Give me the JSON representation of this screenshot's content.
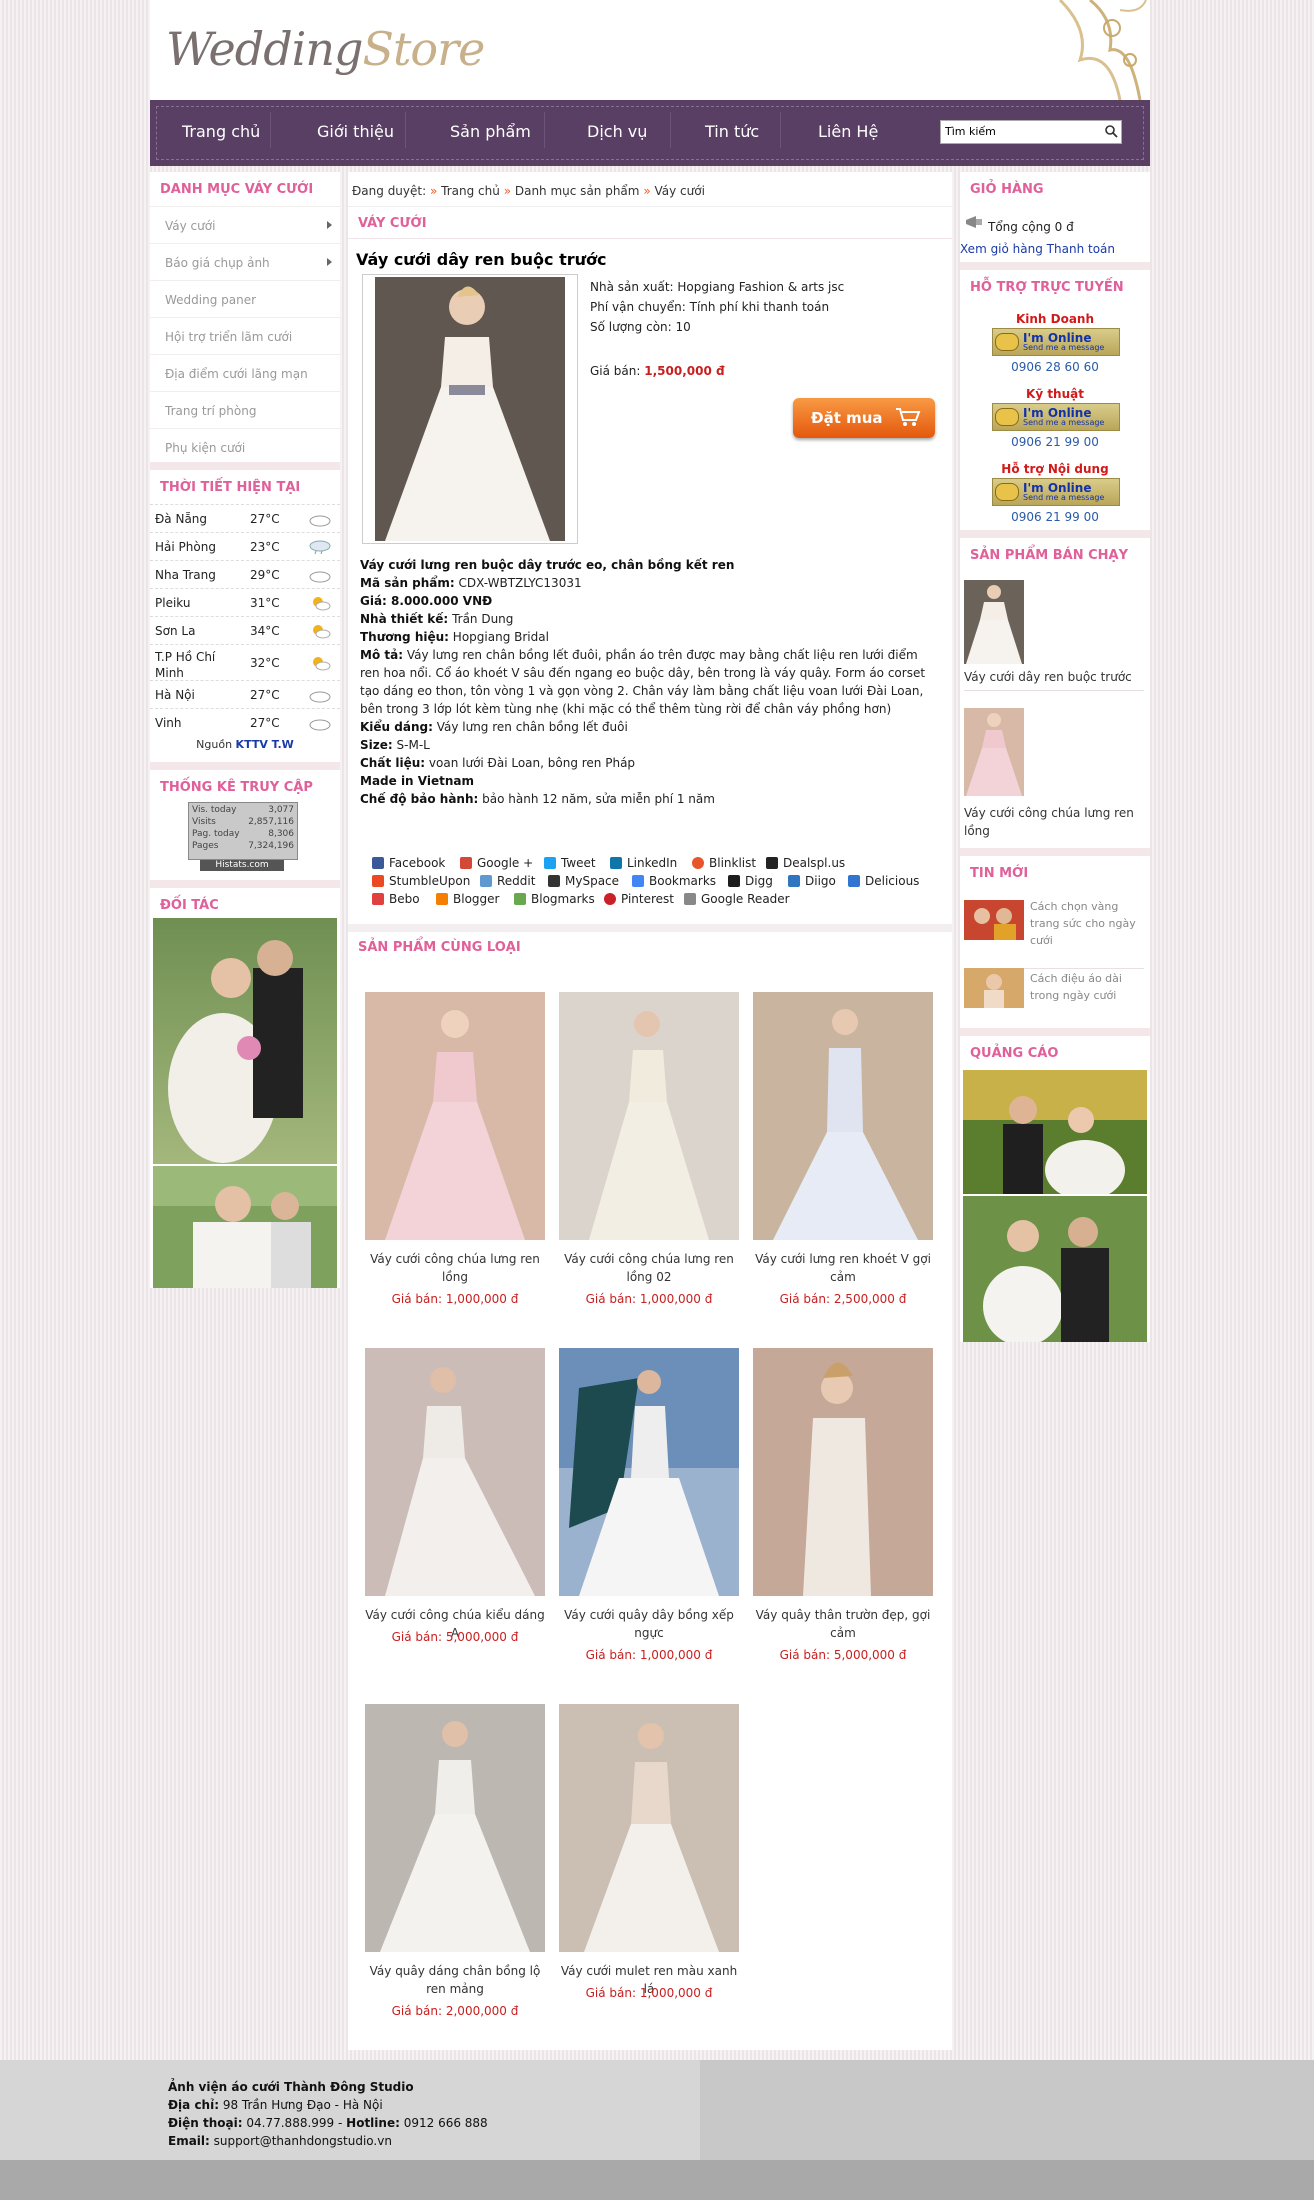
{
  "logo": {
    "part1": "Wedding",
    "part2": "Store"
  },
  "nav": {
    "items": [
      "Trang chủ",
      "Giới thiệu",
      "Sản phẩm",
      "Dịch vụ",
      "Tin tức",
      "Liên Hệ"
    ],
    "search_placeholder": "Tìm kiếm"
  },
  "left": {
    "categories_title": "DANH MỤC VÁY CƯỚI",
    "categories": [
      "Váy cưới",
      "Báo giá chụp ảnh",
      "Wedding paner",
      "Hội trợ triển lãm cưới",
      "Địa điểm cưới lãng mạn",
      "Trang trí phòng",
      "Phụ kiện cưới"
    ],
    "weather_title": "THỜI TIẾT HIỆN TẠI",
    "weather": [
      {
        "city": "Đà Nẵng",
        "temp": "27°C",
        "icon": "cloud-icon"
      },
      {
        "city": "Hải Phòng",
        "temp": "23°C",
        "icon": "rain-icon"
      },
      {
        "city": "Nha Trang",
        "temp": "29°C",
        "icon": "cloud-icon"
      },
      {
        "city": "Pleiku",
        "temp": "31°C",
        "icon": "sun-cloud-icon"
      },
      {
        "city": "Sơn La",
        "temp": "34°C",
        "icon": "sun-cloud-icon"
      },
      {
        "city": "T.P Hồ Chí Minh",
        "temp": "32°C",
        "icon": "sun-cloud-icon"
      },
      {
        "city": "Hà Nội",
        "temp": "27°C",
        "icon": "cloud-icon"
      },
      {
        "city": "Vinh",
        "temp": "27°C",
        "icon": "cloud-icon"
      }
    ],
    "weather_source_label": "Nguồn",
    "weather_source": "KTTV T.W",
    "stats_title": "THỐNG KÊ TRUY CẬP",
    "stats": [
      {
        "label": "Vis. today",
        "value": "3,077"
      },
      {
        "label": "Visits",
        "value": "2,857,116"
      },
      {
        "label": "Pag. today",
        "value": "8,306"
      },
      {
        "label": "Pages",
        "value": "7,324,196"
      }
    ],
    "stats_brand": "Histats.com",
    "partners_title": "ĐỐI TÁC"
  },
  "main": {
    "breadcrumb": [
      "Đang duyệt:",
      "Trang chủ",
      "Danh mục sản phẩm",
      "Váy cưới"
    ],
    "section_title": "VÁY CƯỚI",
    "product_title": "Váy cưới dây ren buộc trước",
    "manufacturer": "Nhà sản xuất: Hopgiang Fashion & arts jsc",
    "shipping": "Phí vận chuyển: Tính phí khi thanh toán",
    "stock": "Số lượng còn: 10",
    "price_label": "Giá bán:",
    "price": "1,500,000 đ",
    "buy_label": "Đặt mua",
    "description": [
      {
        "k": "Váy cưới lưng ren buộc dây trước eo, chân bồng kết ren",
        "v": ""
      },
      {
        "k": "Mã sản phẩm:",
        "v": "CDX-WBTZLYC13031"
      },
      {
        "k": "Giá: 8.000.000 VNĐ",
        "v": ""
      },
      {
        "k": "Nhà thiết kế:",
        "v": "Trần Dung"
      },
      {
        "k": "Thương hiệu:",
        "v": "Hopgiang Bridal"
      },
      {
        "k": "Mô tả:",
        "v": "Váy lưng ren chân bồng lết đuôi, phần áo trên được may bằng chất liệu ren lưới điểm ren hoa nổi. Cổ áo khoét V sâu đến ngang eo buộc dây, bên trong là váy quây. Form áo corset tạo dáng eo thon, tôn vòng 1 và gọn vòng 2. Chân váy làm bằng chất liệu voan lưới Đài Loan, bên trong 3 lớp lót kèm tùng nhẹ (khi mặc có thể thêm tùng rời để chân váy phồng hơn)"
      },
      {
        "k": "Kiểu dáng:",
        "v": "Váy lưng ren chân bồng lết đuôi"
      },
      {
        "k": "Size:",
        "v": "S-M-L"
      },
      {
        "k": "Chất liệu:",
        "v": "voan lưới Đài Loan, bông ren Pháp"
      },
      {
        "k": "Made in Vietnam",
        "v": ""
      },
      {
        "k": "Chế độ bảo hành:",
        "v": "bảo hành 12 năm, sửa miễn phí 1 năm"
      }
    ],
    "share": [
      {
        "label": "Facebook",
        "color": "#3b5998"
      },
      {
        "label": "Google +",
        "color": "#d34836"
      },
      {
        "label": "Tweet",
        "color": "#1da1f2"
      },
      {
        "label": "LinkedIn",
        "color": "#0e76a8"
      },
      {
        "label": "Blinklist",
        "color": "#e8552b"
      },
      {
        "label": "Dealspl.us",
        "color": "#222222"
      },
      {
        "label": "StumbleUpon",
        "color": "#eb4924"
      },
      {
        "label": "Reddit",
        "color": "#5f99cf"
      },
      {
        "label": "MySpace",
        "color": "#333333"
      },
      {
        "label": "Bookmarks",
        "color": "#4285f4"
      },
      {
        "label": "Digg",
        "color": "#1d1d1b"
      },
      {
        "label": "Diigo",
        "color": "#2f75c0"
      },
      {
        "label": "Delicious",
        "color": "#3274d1"
      },
      {
        "label": "Bebo",
        "color": "#e04040"
      },
      {
        "label": "Blogger",
        "color": "#f57d00"
      },
      {
        "label": "Blogmarks",
        "color": "#6aa84f"
      },
      {
        "label": "Pinterest",
        "color": "#cb2027"
      },
      {
        "label": "Google Reader",
        "color": "#888888"
      }
    ],
    "related_title": "SẢN PHẨM CÙNG LOẠI",
    "related": [
      {
        "name": "Váy cưới công chúa lưng ren lồng",
        "price": "Giá bán: 1,000,000 đ"
      },
      {
        "name": "Váy cưới công chúa lưng ren lồng 02",
        "price": "Giá bán: 1,000,000 đ"
      },
      {
        "name": "Váy cưới lưng ren khoét V gợi cảm",
        "price": "Giá bán: 2,500,000 đ"
      },
      {
        "name": "Váy cưới công chúa kiểu dáng A",
        "price": "Giá bán: 5,000,000 đ"
      },
      {
        "name": "Váy cưới quây dây bồng xếp ngực",
        "price": "Giá bán: 1,000,000 đ"
      },
      {
        "name": "Váy quây thân trườn đẹp, gợi cảm",
        "price": "Giá bán: 5,000,000 đ"
      },
      {
        "name": "Váy quây dáng chân bồng lộ ren mảng",
        "price": "Giá bán: 2,000,000 đ"
      },
      {
        "name": "Váy cưới mulet ren màu xanh lá",
        "price": "Giá bán: 1,000,000 đ"
      }
    ]
  },
  "right": {
    "cart_title": "GIỎ HÀNG",
    "cart_total": "Tổng cộng 0 đ",
    "cart_link": "Xem giỏ hàng Thanh toán",
    "support_title": "HỖ TRỢ TRỰC TUYẾN",
    "online_text": "I'm Online",
    "online_sub": "Send me a message",
    "support": [
      {
        "name": "Kinh Doanh",
        "phone": "0906 28 60 60"
      },
      {
        "name": "Kỹ thuật",
        "phone": "0906 21 99 00"
      },
      {
        "name": "Hỗ trợ Nội dung",
        "phone": "0906 21 99 00"
      }
    ],
    "bestseller_title": "SẢN PHẨM BÁN CHẠY",
    "bestsellers": [
      "Váy cưới dây ren buộc trước",
      "Váy cưới công chúa lưng ren lồng"
    ],
    "news_title": "TIN MỚI",
    "news": [
      "Cách chọn vàng trang sức cho ngày cưới",
      "Cách điệu áo dài trong ngày cưới"
    ],
    "ads_title": "QUẢNG CÁO"
  },
  "footer": {
    "studio": "Ảnh viện áo cưới Thành Đông Studio",
    "address_label": "Địa chỉ:",
    "address": "98 Trần Hưng Đạo - Hà Nội",
    "phone_label": "Điện thoại:",
    "phone": "04.77.888.999",
    "hotline_label": "Hotline:",
    "hotline": "0912 666 888",
    "email_label": "Email:",
    "email": "support@thanhdongstudio.vn"
  }
}
